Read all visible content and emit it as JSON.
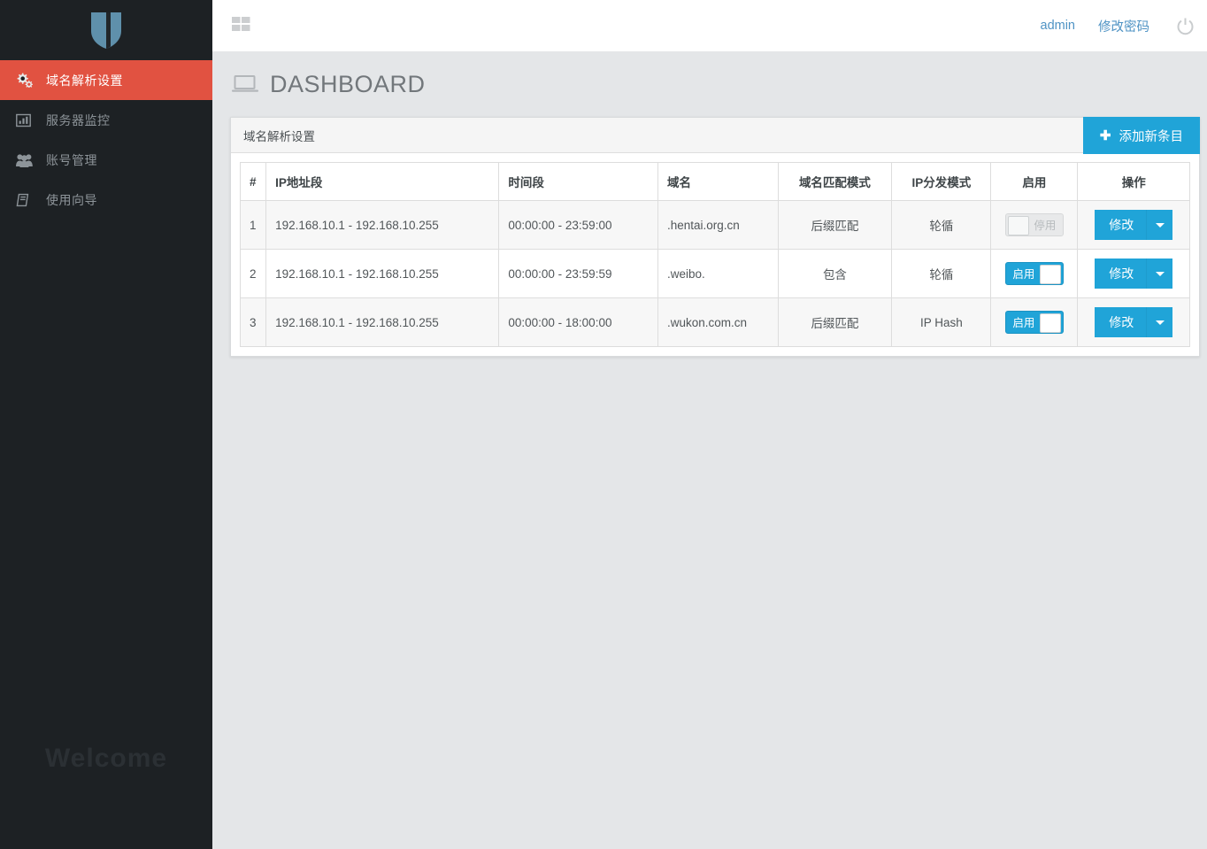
{
  "brand": {
    "logo_icon": "shield-icon"
  },
  "sidebar": {
    "welcome_text": "Welcome",
    "items": [
      {
        "label": "域名解析设置",
        "icon": "cogs-icon",
        "active": true
      },
      {
        "label": "服务器监控",
        "icon": "bar-chart-icon",
        "active": false
      },
      {
        "label": "账号管理",
        "icon": "users-icon",
        "active": false
      },
      {
        "label": "使用向导",
        "icon": "book-icon",
        "active": false
      }
    ]
  },
  "topbar": {
    "grid_icon": "grid-icon",
    "user_label": "admin",
    "change_password_label": "修改密码",
    "power_icon": "power-icon"
  },
  "page": {
    "title": "DASHBOARD",
    "title_icon": "laptop-icon"
  },
  "panel": {
    "title": "域名解析设置",
    "add_button_label": "添加新条目",
    "add_button_icon": "plus-icon"
  },
  "table": {
    "headers": [
      "#",
      "IP地址段",
      "时间段",
      "域名",
      "域名匹配模式",
      "IP分发模式",
      "启用",
      "操作"
    ],
    "rows": [
      {
        "index": "1",
        "ip_range": "192.168.10.1 - 192.168.10.255",
        "time_range": "00:00:00 - 23:59:00",
        "domain": ".hentai.org.cn",
        "match_mode": "后缀匹配",
        "dist_mode": "轮循",
        "enabled": false,
        "toggle_label": "停用",
        "action_label": "修改"
      },
      {
        "index": "2",
        "ip_range": "192.168.10.1 - 192.168.10.255",
        "time_range": "00:00:00 - 23:59:59",
        "domain": ".weibo.",
        "match_mode": "包含",
        "dist_mode": "轮循",
        "enabled": true,
        "toggle_label": "启用",
        "action_label": "修改"
      },
      {
        "index": "3",
        "ip_range": "192.168.10.1 - 192.168.10.255",
        "time_range": "00:00:00 - 18:00:00",
        "domain": ".wukon.com.cn",
        "match_mode": "后缀匹配",
        "dist_mode": "IP Hash",
        "enabled": true,
        "toggle_label": "启用",
        "action_label": "修改"
      }
    ]
  },
  "colors": {
    "accent_blue": "#20a4d8",
    "active_red": "#e15241",
    "sidebar_dark": "#1d2124",
    "link_blue": "#4f93c4",
    "page_bg": "#e4e6e8"
  }
}
